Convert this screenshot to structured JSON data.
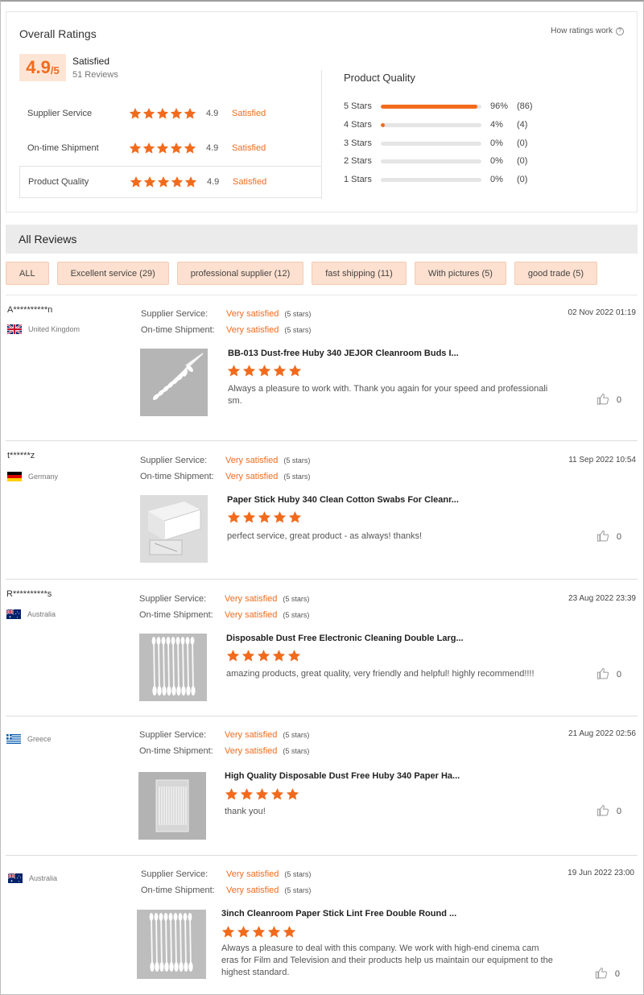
{
  "overall": {
    "title": "Overall Ratings",
    "how_link": "How ratings work",
    "score": "4.9",
    "score_suffix": "/5",
    "satisfaction": "Satisfied",
    "review_count": "51 Reviews",
    "metrics": [
      {
        "label": "Supplier Service",
        "score": "4.9",
        "word": "Satisfied",
        "stars": 5
      },
      {
        "label": "On-time Shipment",
        "score": "4.9",
        "word": "Satisfied",
        "stars": 5
      },
      {
        "label": "Product Quality",
        "score": "4.9",
        "word": "Satisfied",
        "stars": 5
      }
    ],
    "breakdown_title": "Product Quality",
    "breakdown": [
      {
        "label": "5 Stars",
        "fraction": 0.96,
        "percent": "96%",
        "count": "(86)"
      },
      {
        "label": "4 Stars",
        "fraction": 0.04,
        "percent": "4%",
        "count": "(4)"
      },
      {
        "label": "3 Stars",
        "fraction": 0,
        "percent": "0%",
        "count": "(0)"
      },
      {
        "label": "2 Stars",
        "fraction": 0,
        "percent": "0%",
        "count": "(0)"
      },
      {
        "label": "1 Stars",
        "fraction": 0,
        "percent": "0%",
        "count": "(0)"
      }
    ]
  },
  "reviews_header": "All Reviews",
  "filters": [
    "ALL",
    "Excellent service (29)",
    "professional supplier (12)",
    "fast shipping (11)",
    "With pictures (5)",
    "good trade (5)"
  ],
  "labels": {
    "supplier_service": "Supplier Service:",
    "ontime_shipment": "On-time Shipment:",
    "very_satisfied": "Very satisfied",
    "five_stars": "(5 stars)"
  },
  "reviews": [
    {
      "name": "A**********n",
      "country": "United Kingdom",
      "flag": "uk",
      "date": "02 Nov 2022 01:19",
      "product": "BB-013 Dust-free Huby 340 JEJOR Cleanroom Buds I...",
      "text": "Always a pleasure to work with. Thank you again for your speed and professionali sm.",
      "likes": "0"
    },
    {
      "name": "t******z",
      "country": "Germany",
      "flag": "de",
      "date": "11 Sep 2022 10:54",
      "product": "Paper Stick Huby 340 Clean Cotton Swabs For Cleanr...",
      "text": "perfect service, great product - as always! thanks!",
      "likes": "0"
    },
    {
      "name": "R**********s",
      "country": "Australia",
      "flag": "au",
      "date": "23 Aug 2022 23:39",
      "product": "Disposable Dust Free Electronic Cleaning Double Larg...",
      "text": "amazing products, great quality, very friendly and helpful! highly recommend!!!!",
      "likes": "0"
    },
    {
      "name": "",
      "country": "Greece",
      "flag": "gr",
      "date": "21 Aug 2022 02:56",
      "product": "High Quality Disposable Dust Free Huby 340 Paper Ha...",
      "text": "thank you!",
      "likes": "0"
    },
    {
      "name": "",
      "country": "Australia",
      "flag": "au",
      "date": "19 Jun 2022 23:00",
      "product": "3inch Cleanroom Paper Stick Lint Free Double Round ...",
      "text": "Always a pleasure to deal with this company. We work with high-end cinema cam eras for Film and Television and their products help us maintain our equipment to the highest standard.",
      "likes": "0"
    }
  ],
  "colors": {
    "accent": "#f26b1d",
    "chip_bg": "#fde0cf",
    "score_bg": "#fde5d6"
  },
  "icons": {
    "star": "star-icon",
    "like": "thumbs-up-icon",
    "help": "question-circle-icon"
  }
}
